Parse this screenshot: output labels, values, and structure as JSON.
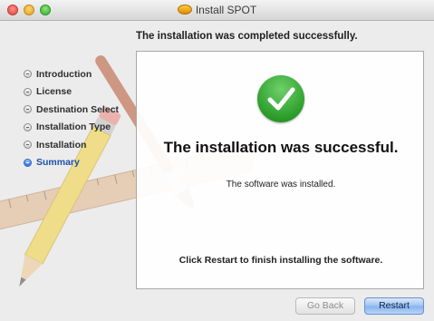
{
  "window": {
    "title": "Install SPOT"
  },
  "header": {
    "text": "The installation was completed successfully."
  },
  "sidebar": {
    "items": [
      {
        "label": "Introduction",
        "state": "done"
      },
      {
        "label": "License",
        "state": "done"
      },
      {
        "label": "Destination Select",
        "state": "done"
      },
      {
        "label": "Installation Type",
        "state": "done"
      },
      {
        "label": "Installation",
        "state": "done"
      },
      {
        "label": "Summary",
        "state": "current"
      }
    ]
  },
  "content": {
    "headline": "The installation was successful.",
    "subline": "The software was installed.",
    "footer_note": "Click Restart to finish installing the software."
  },
  "buttons": {
    "back_label": "Go Back",
    "back_enabled": false,
    "restart_label": "Restart"
  },
  "icons": {
    "status": "checkmark-icon",
    "app": "install-app-icon"
  },
  "colors": {
    "success": "#2b9d2a",
    "accent": "#1e4fa8",
    "default_button": "#9dc2f1"
  }
}
